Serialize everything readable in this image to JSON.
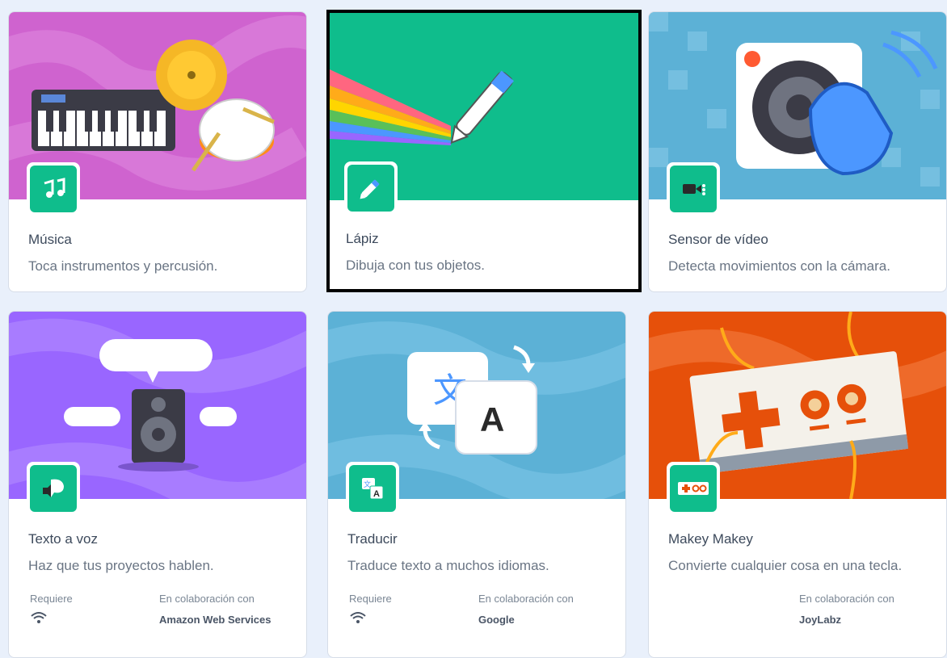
{
  "extensions": [
    {
      "title": "Música",
      "description": "Toca instrumentos y percusión.",
      "icon": "music-notes-icon",
      "color": "#cf63cf"
    },
    {
      "title": "Lápiz",
      "description": "Dibuja con tus objetos.",
      "icon": "pen-icon",
      "color": "#0fbd8c"
    },
    {
      "title": "Sensor de vídeo",
      "description": "Detecta movimientos con la cámara.",
      "icon": "video-camera-icon",
      "color": "#5cb1d6"
    },
    {
      "title": "Texto a voz",
      "description": "Haz que tus proyectos hablen.",
      "icon": "speech-icon",
      "color": "#9966ff",
      "requires_label": "Requiere",
      "collab_label": "En colaboración con",
      "collaborator": "Amazon Web Services"
    },
    {
      "title": "Traducir",
      "description": "Traduce texto a muchos idiomas.",
      "icon": "translate-icon",
      "color": "#5cb1d6",
      "requires_label": "Requiere",
      "collab_label": "En colaboración con",
      "collaborator": "Google"
    },
    {
      "title": "Makey Makey",
      "description": "Convierte cualquier cosa en una tecla.",
      "icon": "makey-makey-icon",
      "color": "#e6500a",
      "collab_label": "En colaboración con",
      "collaborator": "JoyLabz"
    }
  ],
  "selected_extension": "Lápiz",
  "translate_glyphs": {
    "source": "文",
    "target": "A"
  }
}
